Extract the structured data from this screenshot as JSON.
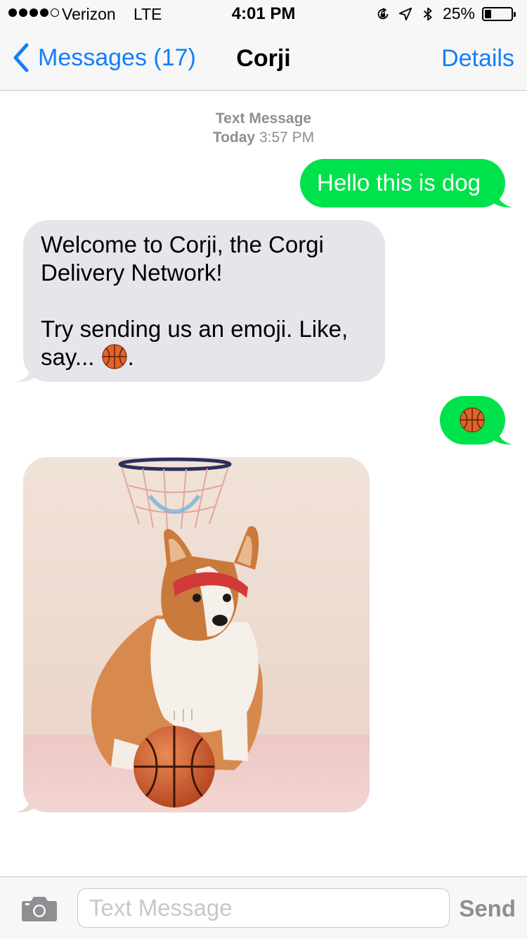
{
  "status_bar": {
    "carrier": "Verizon",
    "network": "LTE",
    "time": "4:01 PM",
    "battery_percent": "25%",
    "battery_level": 0.25,
    "signal_bars_filled": 4,
    "signal_bars_total": 5,
    "icons": [
      "orientation-lock-icon",
      "location-icon",
      "bluetooth-icon",
      "battery-icon"
    ]
  },
  "nav": {
    "back_label": "Messages (17)",
    "title": "Corji",
    "details_label": "Details"
  },
  "conversation": {
    "timestamp_label": "Text Message",
    "timestamp_day": "Today",
    "timestamp_time": "3:57 PM",
    "messages": [
      {
        "direction": "outgoing",
        "text": "Hello this is dog"
      },
      {
        "direction": "incoming",
        "text": "Welcome to Corji, the Corgi\nDelivery Network!\n\nTry sending us an emoji.  Like,\nsay... ",
        "suffix": ".",
        "inline_emoji": "basketball-icon"
      },
      {
        "direction": "outgoing",
        "emoji": "basketball-icon"
      },
      {
        "direction": "incoming",
        "image": "corgi-with-basketball-photo"
      }
    ]
  },
  "input_bar": {
    "placeholder": "Text Message",
    "value": "",
    "send_label": "Send"
  },
  "colors": {
    "accent": "#147efb",
    "outgoing_bubble": "#00e24b",
    "incoming_bubble": "#e5e5ea",
    "bar_background": "#f7f7f7",
    "secondary_text": "#8e8e93"
  }
}
